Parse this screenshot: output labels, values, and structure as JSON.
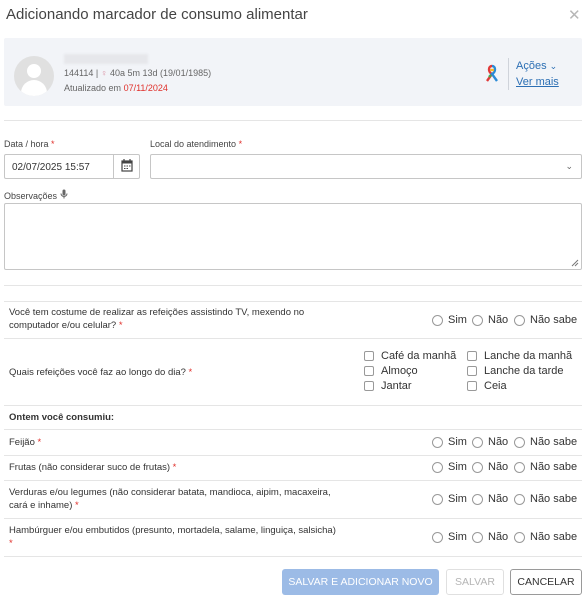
{
  "dialog": {
    "title": "Adicionando marcador de consumo alimentar",
    "close_label": "✕"
  },
  "patient": {
    "id": "144114",
    "separator": "|",
    "gender_icon": "venus-icon",
    "age": "40a 5m 13d (19/01/1985)",
    "updated_prefix": "Atualizado em",
    "updated_date": "07/11/2024",
    "actions_label": "Ações",
    "see_more_label": "Ver mais"
  },
  "form": {
    "datetime_label": "Data / hora",
    "datetime_value": "02/07/2025 15:57",
    "location_label": "Local do atendimento",
    "location_value": "",
    "notes_label": "Observações",
    "notes_value": "",
    "required_mark": "*"
  },
  "questions": {
    "tv": "Você tem costume de realizar as refeições assistindo TV, mexendo no computador e/ou celular?",
    "meals": "Quais refeições você faz ao longo do dia?",
    "meal_options": [
      "Café da manhã",
      "Lanche da manhã",
      "Almoço",
      "Lanche da tarde",
      "Jantar",
      "Ceia"
    ],
    "yesterday_header": "Ontem você consumiu:",
    "feijao": "Feijão",
    "frutas": "Frutas (não considerar suco de frutas)",
    "verduras": "Verduras e/ou legumes (não considerar batata, mandioca, aipim, macaxeira, cará e inhame)",
    "hamburguer": "Hambúrguer e/ou embutidos (presunto, mortadela, salame, linguiça, salsicha)"
  },
  "answers": {
    "sim": "Sim",
    "nao": "Não",
    "nao_sabe": "Não sabe"
  },
  "buttons": {
    "save_add_new": "SALVAR E ADICIONAR NOVO",
    "save": "SALVAR",
    "cancel": "CANCELAR"
  },
  "colors": {
    "accent": "#2c6fb4",
    "required": "#e0302b",
    "primary_disabled": "#9cbbe6"
  }
}
